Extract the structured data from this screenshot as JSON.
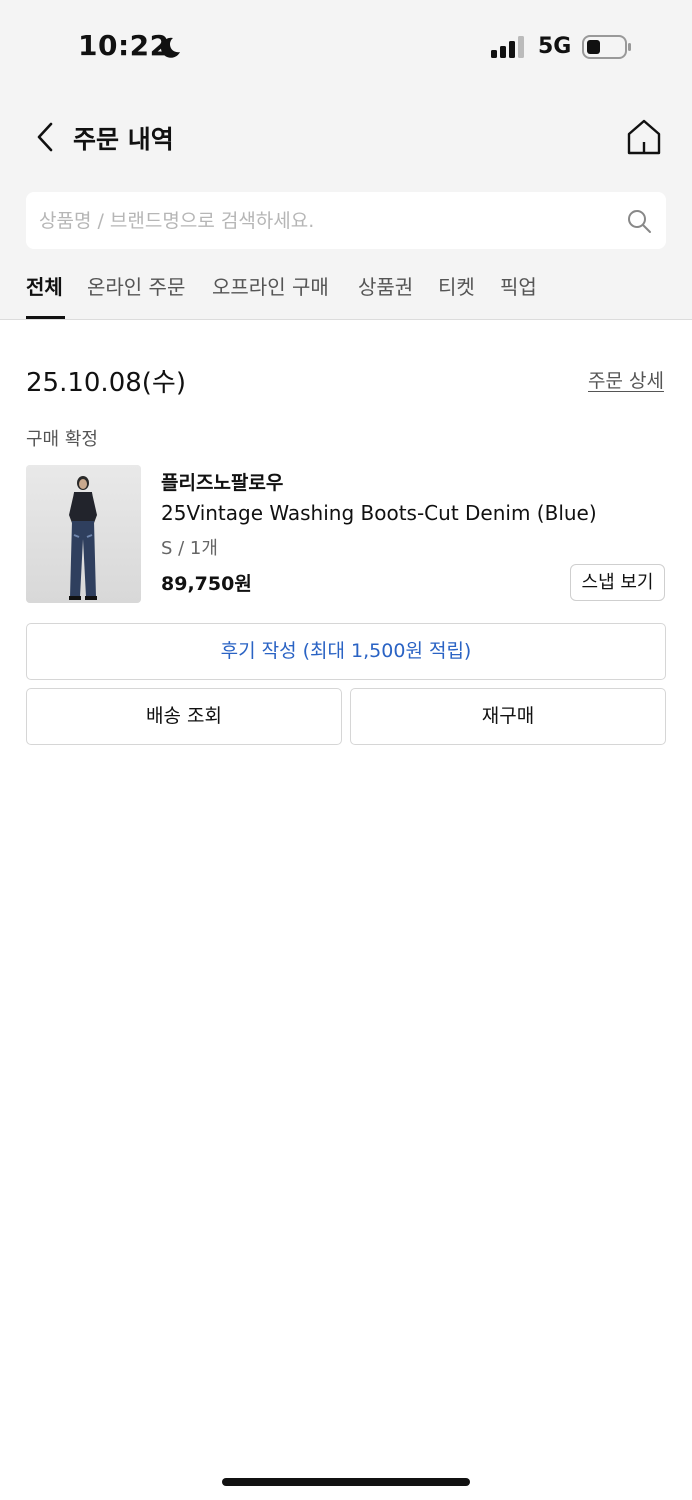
{
  "status_bar": {
    "time": "10:22",
    "network": "5G",
    "icons": [
      "moon-icon",
      "signal-icon",
      "battery-icon"
    ]
  },
  "header": {
    "title": "주문 내역",
    "icons": [
      "back-icon",
      "home-icon"
    ]
  },
  "search": {
    "placeholder": "상품명 / 브랜드명으로 검색하세요.",
    "value": ""
  },
  "tabs": [
    {
      "label": "전체",
      "active": true
    },
    {
      "label": "온라인 주문",
      "active": false
    },
    {
      "label": "오프라인 구매",
      "active": false
    },
    {
      "label": "상품권",
      "active": false
    },
    {
      "label": "티켓",
      "active": false
    },
    {
      "label": "픽업",
      "active": false
    }
  ],
  "order": {
    "date": "25.10.08(수)",
    "detail_link": "주문 상세",
    "status": "구매 확정",
    "item": {
      "brand": "플리즈노팔로우",
      "name": "25Vintage Washing Boots-Cut Denim (Blue)",
      "option": "S / 1개",
      "price": "89,750원",
      "snap_button": "스냅 보기"
    },
    "review_button": "후기 작성 (최대 1,500원 적립)",
    "shipping_button": "배송 조회",
    "rebuy_button": "재구매"
  },
  "colors": {
    "accent": "#2a63c4",
    "background_top": "#f4f4f4"
  }
}
